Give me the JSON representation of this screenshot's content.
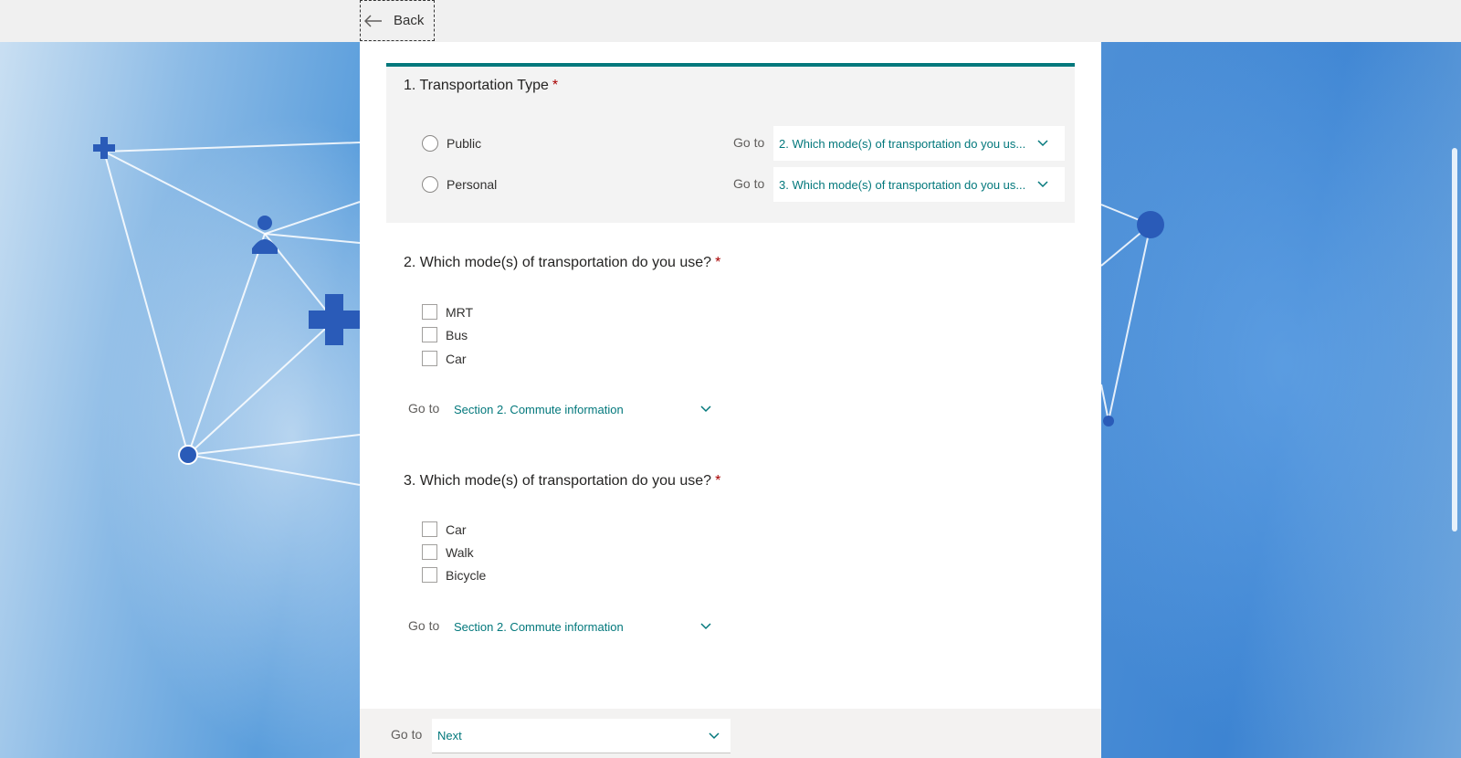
{
  "topbar": {
    "back_label": "Back"
  },
  "form": {
    "questions": [
      {
        "number": "1.",
        "title": "Transportation Type",
        "required": "*",
        "options": [
          {
            "label": "Public",
            "goto_label": "Go to",
            "goto_value": "2. Which mode(s) of transportation do you us..."
          },
          {
            "label": "Personal",
            "goto_label": "Go to",
            "goto_value": "3. Which mode(s) of transportation do you us..."
          }
        ]
      },
      {
        "number": "2.",
        "title": "Which mode(s) of transportation do you use?",
        "required": "*",
        "options": [
          {
            "label": "MRT"
          },
          {
            "label": "Bus"
          },
          {
            "label": "Car"
          }
        ],
        "goto_label": "Go to",
        "goto_value": "Section 2. Commute information"
      },
      {
        "number": "3.",
        "title": "Which mode(s) of transportation do you use?",
        "required": "*",
        "options": [
          {
            "label": "Car"
          },
          {
            "label": "Walk"
          },
          {
            "label": "Bicycle"
          }
        ],
        "goto_label": "Go to",
        "goto_value": "Section 2. Commute information"
      }
    ],
    "footer": {
      "goto_label": "Go to",
      "goto_value": "Next"
    }
  },
  "colors": {
    "accent": "#03787c",
    "required": "#a80000",
    "topbar": "#f0f0f0"
  },
  "icons": [
    "arrow-left-icon",
    "chevron-down-icon"
  ]
}
